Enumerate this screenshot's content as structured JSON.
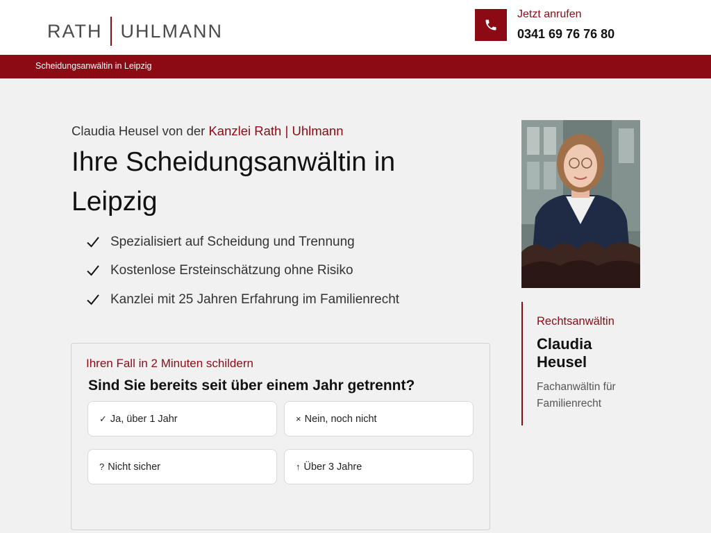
{
  "header": {
    "logo_left": "RATH",
    "logo_right": "UHLMANN",
    "call_label": "Jetzt anrufen",
    "call_number": "0341 69 76 76 80",
    "phone_icon": "phone-icon"
  },
  "breadcrumb": {
    "text": "Scheidungsanwältin in Leipzig"
  },
  "hero": {
    "intro_prefix": "Claudia Heusel von der ",
    "intro_accent_1": "Kanzlei Rath ",
    "intro_pipe": "|",
    "intro_accent_2": " Uhlmann",
    "title": "Ihre Scheidungsanwältin in Leipzig",
    "checks": [
      "Spezialisiert auf Scheidung und Trennung",
      "Kostenlose Ersteinschätzung ohne Risiko",
      "Kanzlei mit 25 Jahren Erfahrung im Familienrecht"
    ]
  },
  "quiz": {
    "kicker": "Ihren Fall in 2 Minuten schildern",
    "question": "Sind Sie bereits seit über einem Jahr getrennt?",
    "options": [
      {
        "glyph": "✓",
        "label": "Ja, über 1 Jahr"
      },
      {
        "glyph": "×",
        "label": "Nein, noch nicht"
      },
      {
        "glyph": "?",
        "label": "Nicht sicher"
      },
      {
        "glyph": "↑",
        "label": "Über 3 Jahre"
      }
    ]
  },
  "profile": {
    "role": "Rechtsanwältin",
    "name": "Claudia Heusel",
    "description": "Fachanwältin für Familienrecht"
  },
  "colors": {
    "brand": "#8b0a14",
    "background": "#f1f1f1"
  }
}
